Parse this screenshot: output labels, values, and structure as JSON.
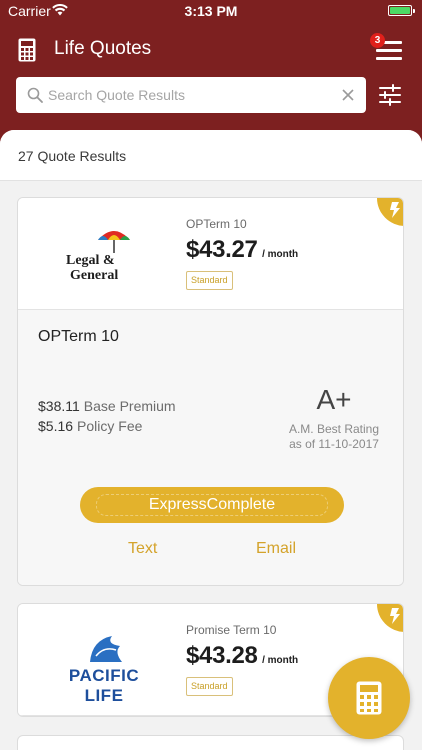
{
  "status_bar": {
    "carrier": "Carrier",
    "time": "3:13 PM"
  },
  "header": {
    "app_title": "Life Quotes",
    "menu_badge_count": "3",
    "brand_color": "#7d2020",
    "accent_color": "#e3b22c"
  },
  "search": {
    "placeholder": "Search Quote Results",
    "value": ""
  },
  "results": {
    "count_label": "27 Quote Results",
    "quotes": [
      {
        "carrier_logo": "legal-and-general-logo",
        "logo_text_1": "Legal &",
        "logo_text_2": "General",
        "plan_label": "OPTerm 10",
        "price": "$43.27",
        "per_month": "/ month",
        "badge": "Standard",
        "plan_name": "OPTerm 10",
        "fees": [
          {
            "amount": "$38.11",
            "label": "Base Premium"
          },
          {
            "amount": "$5.16",
            "label": "Policy Fee"
          }
        ],
        "rating": "A+",
        "rating_label_1": "A.M. Best Rating",
        "rating_label_2": "as of 11-10-2017",
        "action_button": "ExpressComplete",
        "link_text": "Text",
        "link_email": "Email"
      },
      {
        "carrier_logo": "pacific-life-logo",
        "logo_text_1": "PACIFIC LIFE",
        "plan_label": "Promise Term 10",
        "price": "$43.28",
        "per_month": "/ month",
        "badge": "Standard"
      }
    ]
  }
}
